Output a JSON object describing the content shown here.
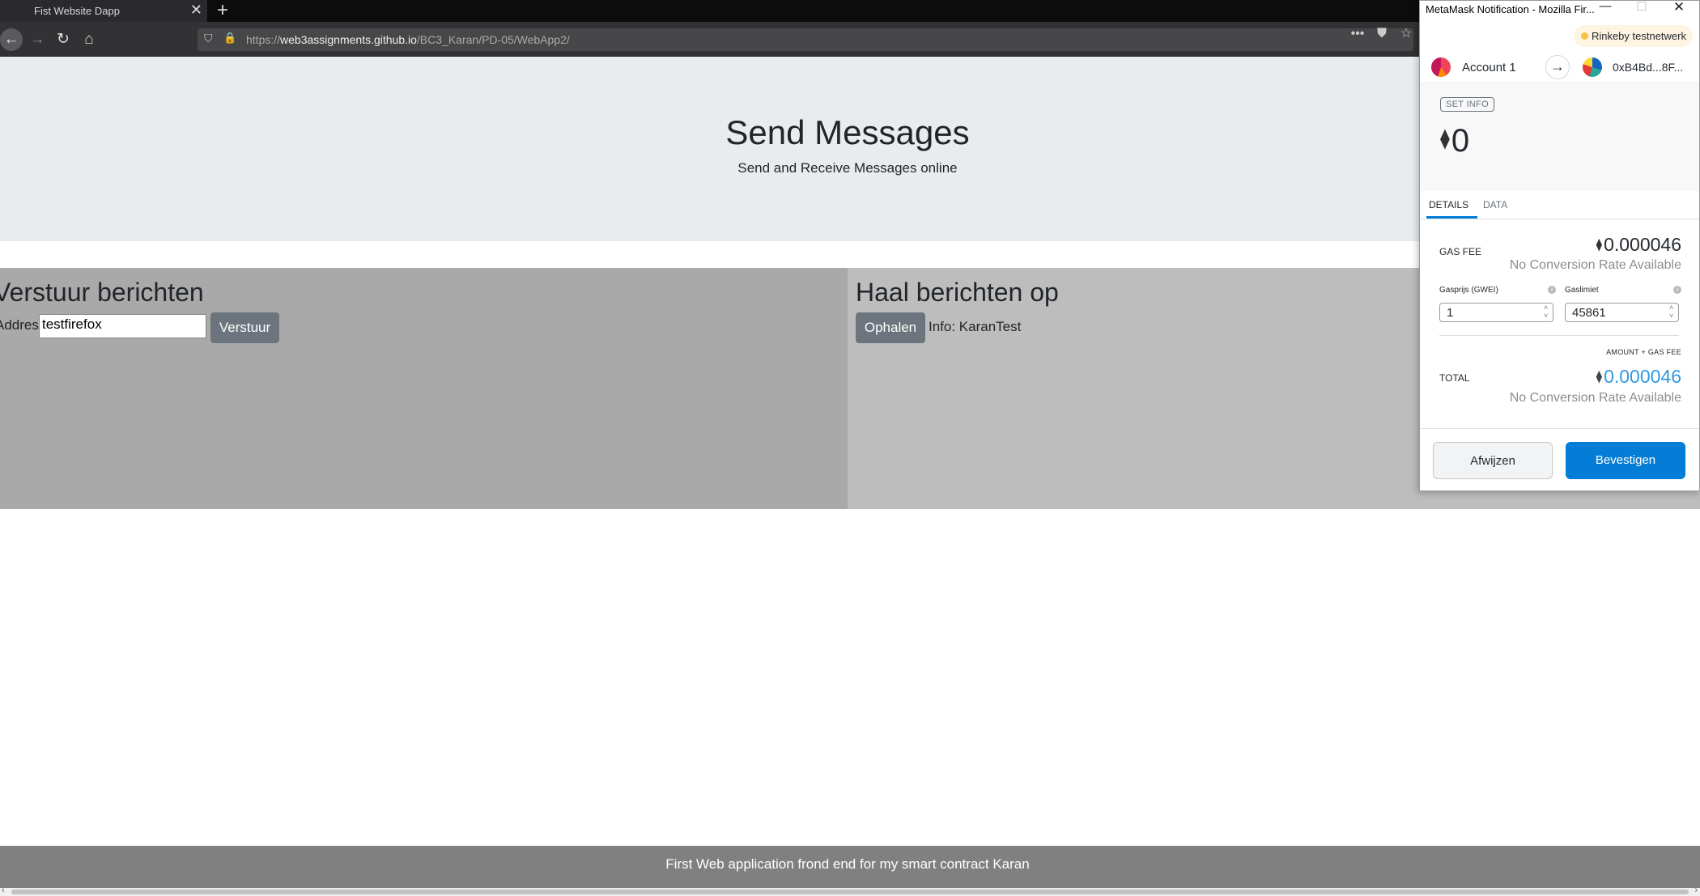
{
  "browser": {
    "tab_title": "Fist Website Dapp",
    "tab_close": "✕",
    "new_tab": "+",
    "url_prefix": "https://",
    "url_host": "web3assignments.github.io",
    "url_path": "/BC3_Karan/PD-05/WebApp2/",
    "icons": [
      "back-arrow-icon",
      "forward-arrow-icon",
      "reload-icon",
      "home-icon",
      "shield-icon",
      "lock-icon",
      "more-icon",
      "pocket-icon",
      "bookmark-star-icon"
    ]
  },
  "page": {
    "hero_title": "Send Messages",
    "hero_subtitle": "Send and Receive Messages online",
    "send": {
      "title": "Verstuur berichten",
      "address_label": "Address:",
      "address_value": "testfirefox",
      "button": "Verstuur"
    },
    "fetch": {
      "title": "Haal berichten op",
      "button": "Ophalen",
      "info": "Info: KaranTest"
    },
    "footer": "First Web application frond end for my smart contract Karan"
  },
  "metamask": {
    "window_title": "MetaMask Notification - Mozilla Fir...",
    "network": "Rinkeby testnetwerk",
    "account_name": "Account 1",
    "to_address": "0xB4Bd...8F...",
    "action_label": "SET INFO",
    "amount": "0",
    "tabs": [
      "DETAILS",
      "DATA"
    ],
    "active_tab": "DETAILS",
    "gas_fee_label": "GAS FEE",
    "gas_fee_value": "0.000046",
    "no_conversion": "No Conversion Rate Available",
    "gas_price_label": "Gasprijs (GWEI)",
    "gas_price_value": "1",
    "gas_limit_label": "Gaslimiet",
    "gas_limit_value": "45861",
    "amount_plus_gas": "AMOUNT + GAS FEE",
    "total_label": "TOTAL",
    "total_value": "0.000046",
    "reject_button": "Afwijzen",
    "confirm_button": "Bevestigen",
    "colors": {
      "confirm": "#037dd6",
      "total": "#2f9ae0",
      "network_dot": "#f6c343"
    }
  }
}
